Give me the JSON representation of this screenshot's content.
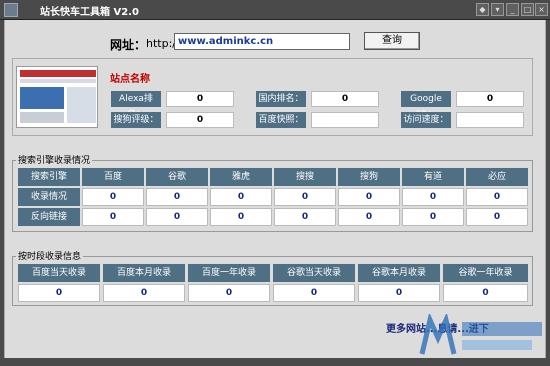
{
  "window": {
    "title": "站长快车工具箱 V2.0"
  },
  "url_row": {
    "label": "网址：",
    "prefix": "http://",
    "value": "www.adminkc.cn",
    "query_label": "查询"
  },
  "site": {
    "name": "站点名称",
    "labels": [
      "Alexa排名：",
      "国内排名：",
      "Google PR：",
      "搜狗评级：",
      "百度快照：",
      "访问速度："
    ],
    "values": [
      "0",
      "0",
      "0",
      "0",
      "",
      ""
    ]
  },
  "search_section": {
    "title": "搜索引擎收录情况",
    "engines": [
      "搜索引擎",
      "百度",
      "谷歌",
      "雅虎",
      "搜搜",
      "搜狗",
      "有道",
      "必应"
    ],
    "rows": [
      {
        "label": "收录情况",
        "values": [
          "0",
          "0",
          "0",
          "0",
          "0",
          "0",
          "0"
        ]
      },
      {
        "label": "反向链接",
        "values": [
          "0",
          "0",
          "0",
          "0",
          "0",
          "0",
          "0"
        ]
      }
    ]
  },
  "time_section": {
    "title": "按时段收录信息",
    "headers": [
      "百度当天收录",
      "百度本月收录",
      "百度一年收录",
      "谷歌当天收录",
      "谷歌本月收录",
      "谷歌一年收录"
    ],
    "values": [
      "0",
      "0",
      "0",
      "0",
      "0",
      "0"
    ]
  },
  "footer": {
    "more_link": "更多网站...息请...进下"
  },
  "colors": {
    "header_bg": "#4f6f84",
    "title_bar": "#4a4a4a",
    "accent_red": "#c00000"
  }
}
